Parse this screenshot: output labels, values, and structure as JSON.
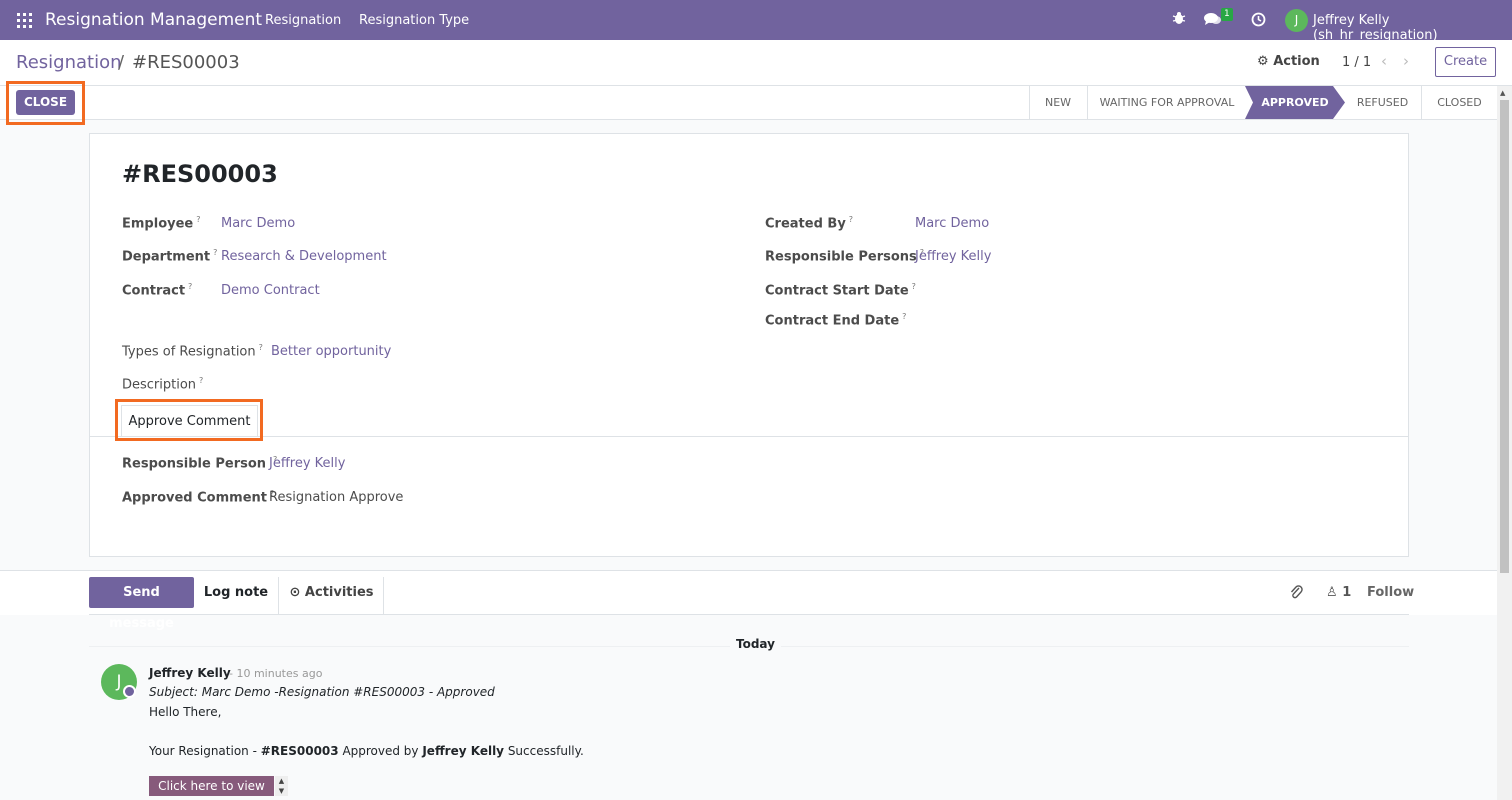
{
  "navbar": {
    "app_title": "Resignation Management",
    "menu": [
      "Resignation",
      "Resignation Type"
    ],
    "chat_badge": "1",
    "user_initial": "J",
    "user_name": "Jeffrey Kelly (sh_hr_resignation)"
  },
  "control_panel": {
    "breadcrumb_root": "Resignation",
    "breadcrumb_sep": "/",
    "breadcrumb_current": "#RES00003",
    "action_label": "Action",
    "pager": "1 / 1",
    "create_label": "Create"
  },
  "statusbar": {
    "close_label": "CLOSE",
    "stages": [
      "NEW",
      "WAITING FOR APPROVAL",
      "APPROVED",
      "REFUSED",
      "CLOSED"
    ],
    "active_stage": "APPROVED"
  },
  "form": {
    "title": "#RES00003",
    "employee_label": "Employee",
    "employee_value": "Marc Demo",
    "department_label": "Department",
    "department_value": "Research & Development",
    "contract_label": "Contract",
    "contract_value": "Demo Contract",
    "created_by_label": "Created By",
    "created_by_value": "Marc Demo",
    "responsible_persons_label": "Responsible Persons",
    "responsible_persons_value": "Jeffrey Kelly",
    "contract_start_label": "Contract Start Date",
    "contract_end_label": "Contract End Date",
    "types_label": "Types of Resignation",
    "types_value": "Better opportunity",
    "description_label": "Description",
    "tab_label": "Approve Comment",
    "responsible_person_label": "Responsible Person",
    "responsible_person_value": "Jeffrey Kelly",
    "approved_comment_label": "Approved Comment",
    "approved_comment_value": "Resignation Approve",
    "help_mark": "?"
  },
  "chatter": {
    "send_label": "Send message",
    "log_label": "Log note",
    "activities_label": "Activities",
    "follower_count": "1",
    "follow_label": "Follow",
    "date_sep": "Today",
    "message": {
      "avatar_initial": "J",
      "author": "Jeffrey Kelly",
      "time": "- 10 minutes ago",
      "subject": "Subject: Marc Demo -Resignation #RES00003 - Approved",
      "greeting": "Hello There,",
      "body_prefix": "Your Resignation - ",
      "body_ref": "#RES00003",
      "body_mid": " Approved by ",
      "body_user": "Jeffrey Kelly",
      "body_suffix": " Successfully.",
      "button_label": "Click here to view"
    }
  },
  "colors": {
    "brand": "#71639e",
    "highlight": "#f26a21",
    "avatar": "#5cb85c"
  }
}
